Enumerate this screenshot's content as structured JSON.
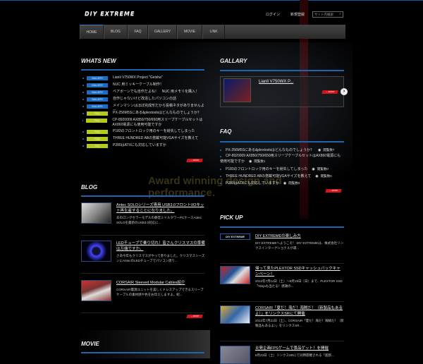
{
  "header": {
    "logo": "DIY EXTREME",
    "login": "ログイン",
    "register": "新規登録",
    "search_placeholder": "サイト内検索",
    "search_icon": "magnifier"
  },
  "nav": [
    {
      "label": "HOME",
      "active": true
    },
    {
      "label": "BLOG"
    },
    {
      "label": "FAQ"
    },
    {
      "label": "GALLERY"
    },
    {
      "label": "MOVIE"
    },
    {
      "label": "LINK"
    }
  ],
  "background_text": "Award winning design and performance.",
  "whats_new": {
    "title": "WHATS NEW",
    "more": "→ MORE",
    "items": [
      {
        "badge": "GALLERY",
        "text": "Lianli V750WX Project \"Geisha\""
      },
      {
        "badge": "GALLERY",
        "text": "NUC 用ミッキーケーブル制作！"
      },
      {
        "badge": "GALLERY",
        "text": "ベアボーンでも自作だよね！　NUC 用メモリを購入！"
      },
      {
        "badge": "GALLERY",
        "text": "自作じゃないけど改造したパソコンの話"
      },
      {
        "badge": "GALLERY",
        "text": "メインマシンはほぼ完成形だから投稿ネタがありませんよー"
      },
      {
        "badge": "FAQ",
        "text": "PX-256M5Sにある&plextoolsはどんなものでしょうか？"
      },
      {
        "badge": "FAQ",
        "text": "CP-8920009 AX850/750/650用スリーブケーブルセットはAX860電源にも使用可能ですか"
      },
      {
        "badge": "FAQ",
        "text": "P183のフロントロック用のキーを紛失してしまった"
      },
      {
        "badge": "FAQ",
        "text": "THREE HUNDRED ABの搭載可能VGAサイズを教えて"
      },
      {
        "badge": "FAQ",
        "text": "P280はATXにも対応していますか"
      }
    ]
  },
  "gallery": {
    "title": "GALLARY",
    "item_title": "Lianli V750WX P...",
    "more": "→ MORE"
  },
  "faq": {
    "title": "FAQ",
    "more": "→ MORE",
    "items": [
      {
        "q": "PX-256M5Sにある&plextoolsはどんなものでしょうか？",
        "views": "閲覧数7"
      },
      {
        "q": "CP-8920009 AX850/750/650用スリーブケーブルセットはAX860電源にも使用可能ですか",
        "views": "閲覧数1"
      },
      {
        "q": "P183のフロントロック用のキーを紛失してしまった",
        "views": "閲覧数0"
      },
      {
        "q": "THREE HUNDRED ABの搭載可能VGAサイズを教えて",
        "views": "閲覧数0"
      },
      {
        "q": "P280はATXにも対応していますか",
        "views": "閲覧数0"
      }
    ]
  },
  "blog": {
    "title": "BLOG",
    "more": "→ MORE",
    "items": [
      {
        "title": "Antec SOLOシリーズ専用 USB3.0フロントI/Oキット再生産することになりました。",
        "desc": "あのロングセラーモデルの静音ミドルタワーPCケースAntec SOLOを最新のUSB3.0対応に..."
      },
      {
        "title": "LEDチューブで乗り切れ！皆さんクリスマスの準備は万端ですか。",
        "desc": "さあ今年もクリスマスがやって参りました。クリスマスシーズンにAntecのLEDチューブでパソコン周り..."
      },
      {
        "title": "CORSAIR Sleeved Modular Cables紹介",
        "desc": "CORSAIR電源ユニットを美しくドレスアップできるスリーブケーブルの素材感や色をお伝えしますよ。紹..."
      }
    ]
  },
  "movie": {
    "title": "MOVIE"
  },
  "pickup": {
    "title": "PICK UP",
    "items": [
      {
        "badge": "DIY EXTREME",
        "title": "DIY EXTREMEの楽しみ方",
        "desc": "DIY EXTREMEへようこそ！ DIY EXTREMEは、株式会社リンクスインターナショナルが運..."
      },
      {
        "title": "帰って来たPLEXTOR SSDキャッシュバックキャンペーン！",
        "desc": "2012年7月14日（土）～8月19日（日）まで、PLEXTOR SSD「Ninjaも当たる！感謝の..."
      },
      {
        "title": "CORSAIR「夏だ！海だ！海賊だ！（新製品もあるよ）」をリンクスSRにて開催",
        "desc": "2012年7月21日（土）、CORSAIR「夏だ！海だ！海賊だ！（新製品もあるよ）」をリンクスSR..."
      },
      {
        "title": "炎発企画FPSゲームで景品ゲット！を開催",
        "desc": "6月23日（土）リンクスSRにて同時開催される「超新..."
      }
    ]
  }
}
